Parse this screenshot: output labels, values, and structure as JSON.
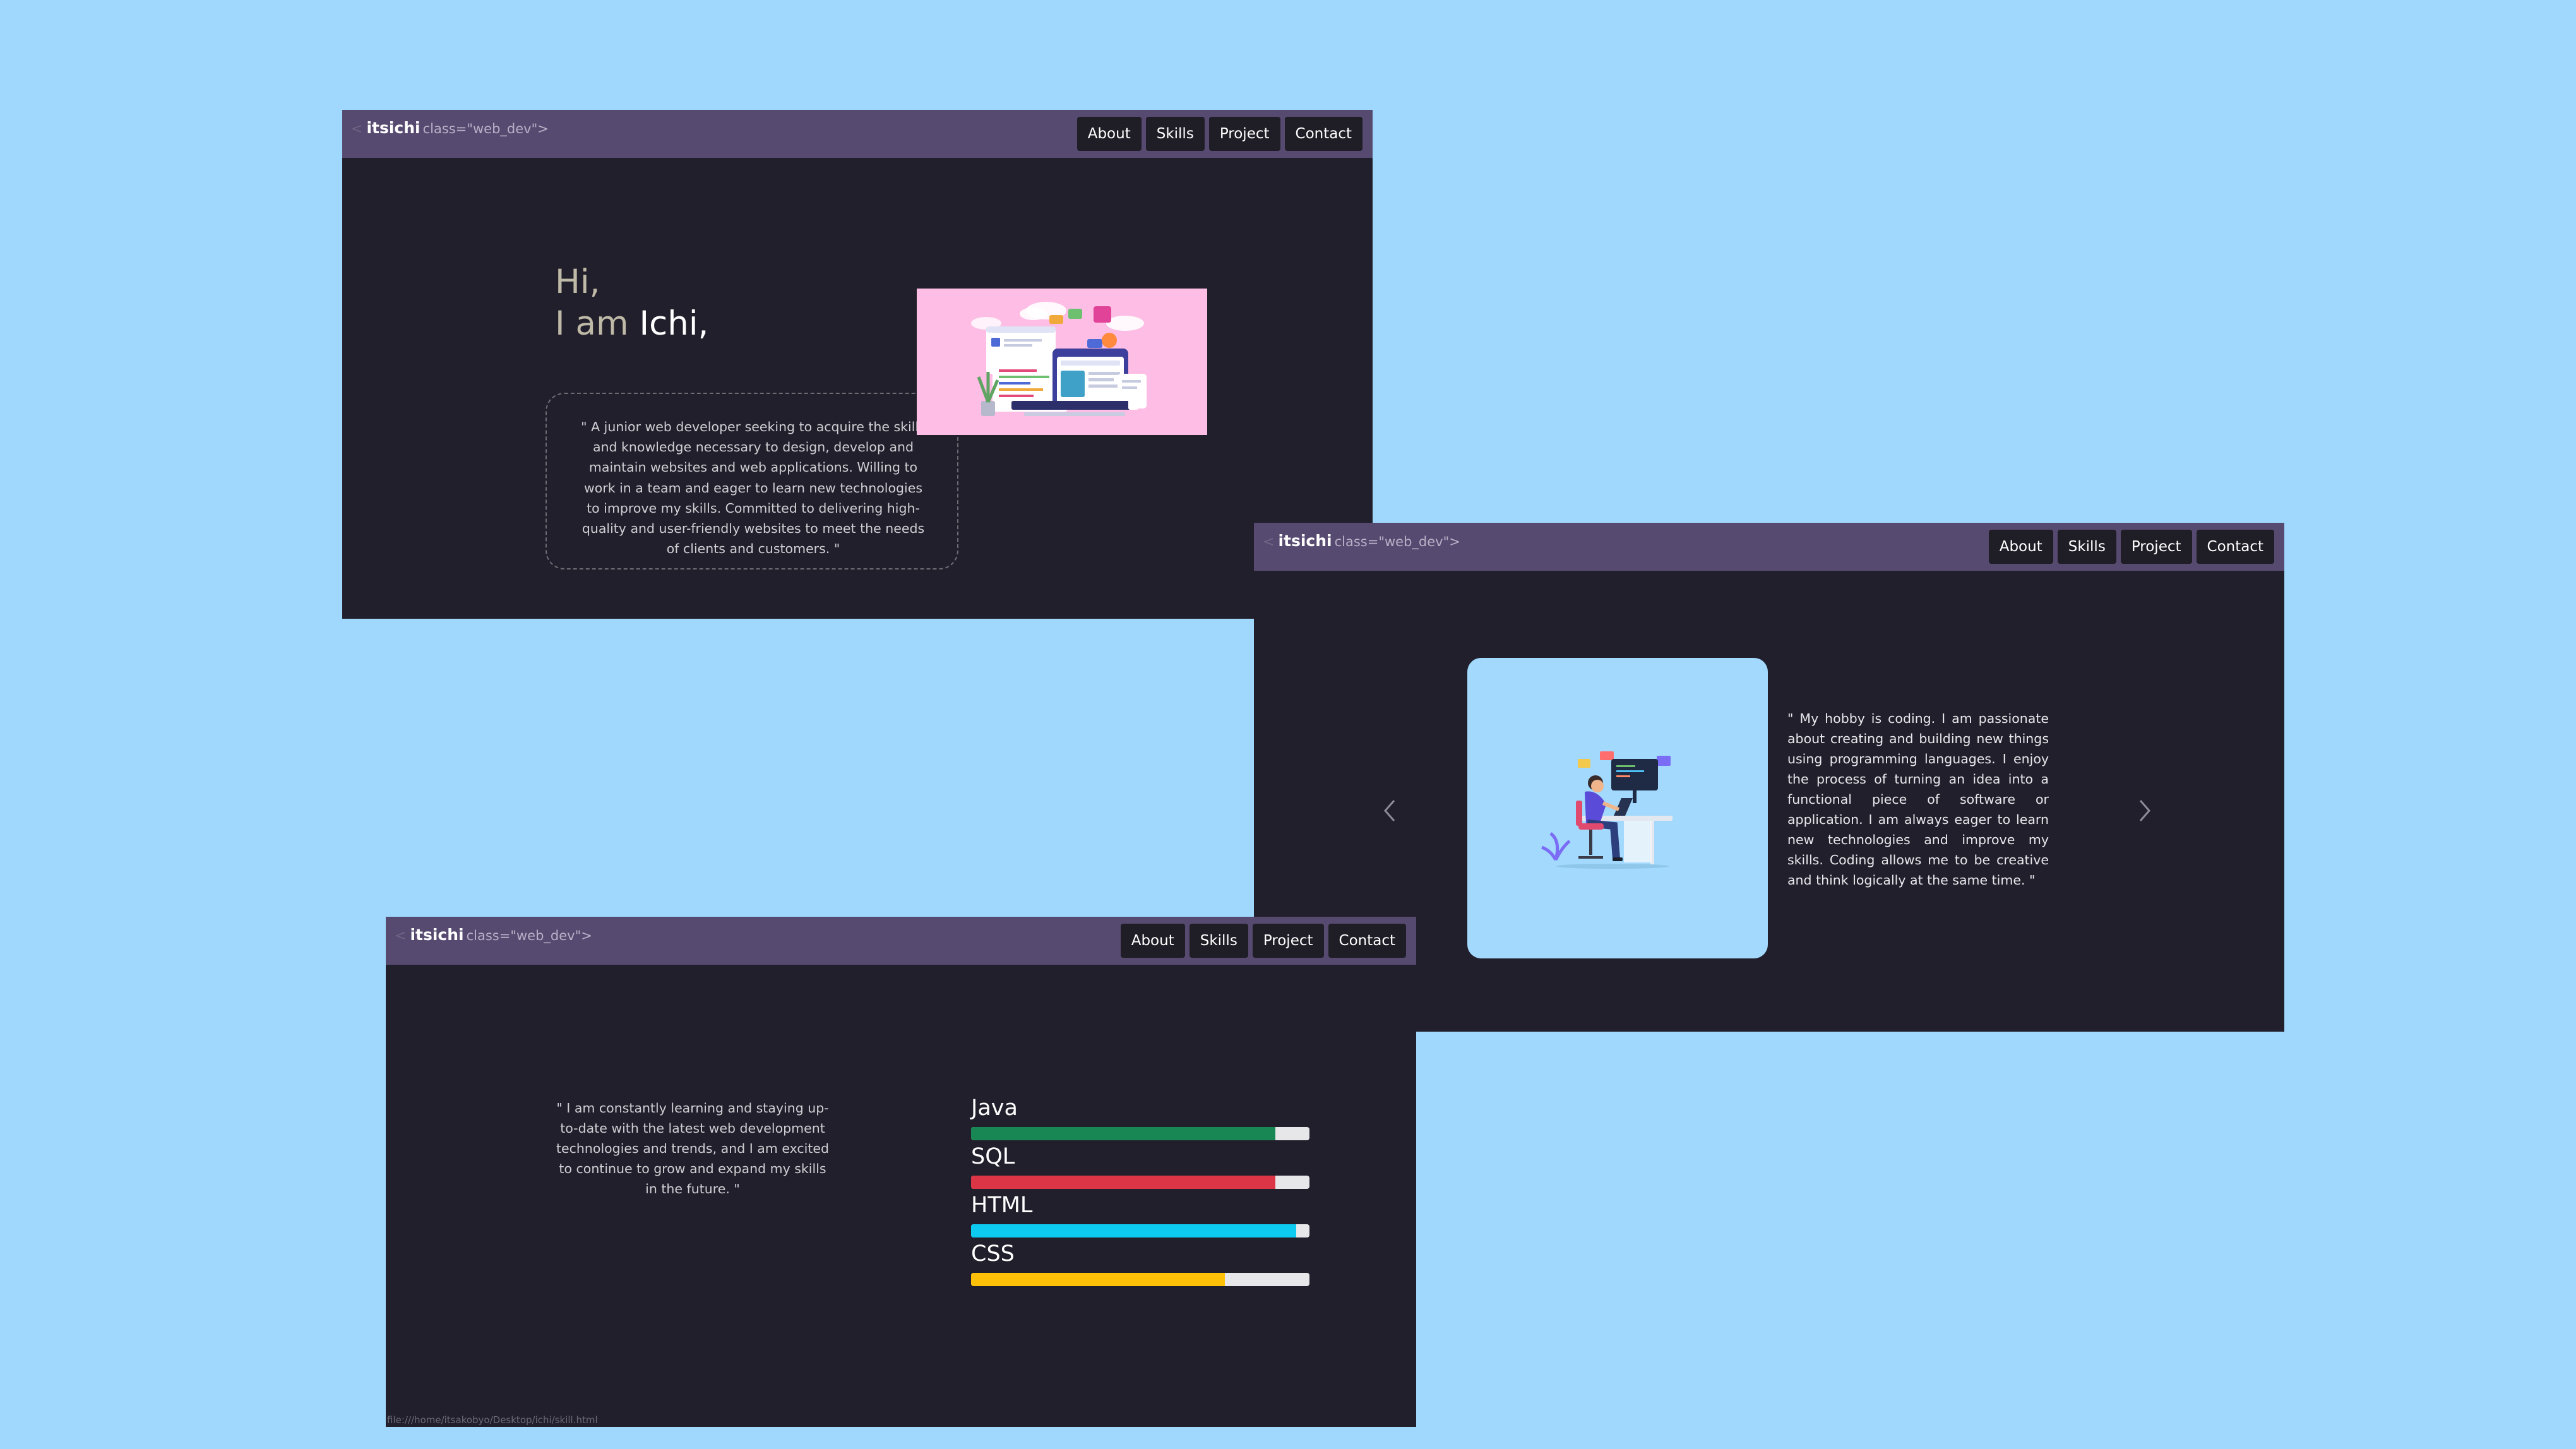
{
  "nav": {
    "brand_prefix": "<",
    "brand_name": "itsichi",
    "brand_attr": "class=\"web_dev\">",
    "links": [
      "About",
      "Skills",
      "Project",
      "Contact"
    ]
  },
  "hero": {
    "greeting_line1": "Hi,",
    "greeting_prefix": "I am",
    "greeting_name": "Ichi,",
    "quote": "\" A junior web developer seeking to acquire the skills and knowledge necessary to design, develop and maintain websites and web applications. Willing to work in a team and eager to learn new technologies to improve my skills. Committed to delivering high-quality and user-friendly websites to meet the needs of clients and customers. \""
  },
  "about": {
    "text": "\" My hobby is coding. I am passionate about creating and building new things using programming languages. I enjoy the process of turning an idea into a functional piece of software or application. I am always eager to learn new technologies and improve my skills. Coding allows me to be creative and think logically at the same time. \""
  },
  "skills": {
    "text": "\" I am constantly learning and staying up-to-date with the latest web development technologies and trends, and I am excited to continue to grow and expand my skills in the future. \"",
    "items": [
      {
        "label": "Java",
        "level": 0.9,
        "color": "#198754"
      },
      {
        "label": "SQL",
        "level": 0.9,
        "color": "#dc3545"
      },
      {
        "label": "HTML",
        "level": 0.96,
        "color": "#0dcaf0"
      },
      {
        "label": "CSS",
        "level": 0.75,
        "color": "#ffc107"
      }
    ],
    "status_url": "file:///home/itsakobyo/Desktop/ichi/skill.html"
  },
  "colors": {
    "page_bg": "#a0d8fd",
    "window_bg": "#221f2c",
    "navbar_bg": "#574a70",
    "nav_button_bg": "#1f1e26",
    "hero_illustration_bg": "#fdbde4",
    "about_card_bg": "#a2d9fd"
  },
  "icons": {
    "prev": "chevron-left-icon",
    "next": "chevron-right-icon"
  }
}
